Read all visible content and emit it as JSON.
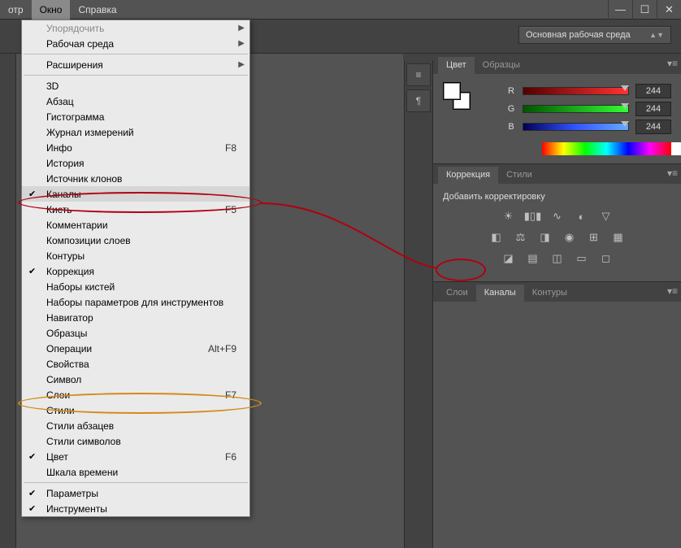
{
  "menubar": {
    "left_cut": "отр",
    "window": "Окно",
    "help": "Справка"
  },
  "win": {
    "min": "—",
    "max": "☐",
    "close": "✕"
  },
  "workspace": {
    "label": "Основная рабочая среда"
  },
  "dropdown": {
    "arrange": "Упорядочить",
    "workspace": "Рабочая среда",
    "extensions": "Расширения",
    "threeD": "3D",
    "paragraph": "Абзац",
    "histogram": "Гистограмма",
    "measurementLog": "Журнал измерений",
    "info": "Инфо",
    "info_sc": "F8",
    "history": "История",
    "cloneSrc": "Источник клонов",
    "channels": "Каналы",
    "brush": "Кисть",
    "brush_sc": "F5",
    "notes": "Комментарии",
    "layerComps": "Композиции слоев",
    "paths": "Контуры",
    "adjustments": "Коррекция",
    "brushPresets": "Наборы кистей",
    "toolPresets": "Наборы параметров для инструментов",
    "navigator": "Навигатор",
    "swatches": "Образцы",
    "actions": "Операции",
    "actions_sc": "Alt+F9",
    "properties": "Свойства",
    "character": "Символ",
    "layers": "Слои",
    "layers_sc": "F7",
    "styles": "Стили",
    "paraStyles": "Стили абзацев",
    "charStyles": "Стили символов",
    "color": "Цвет",
    "color_sc": "F6",
    "timeline": "Шкала времени",
    "options": "Параметры",
    "tools": "Инструменты"
  },
  "colorPanel": {
    "tab_color": "Цвет",
    "tab_swatches": "Образцы",
    "r_label": "R",
    "g_label": "G",
    "b_label": "B",
    "r_val": "244",
    "g_val": "244",
    "b_val": "244"
  },
  "adjPanel": {
    "tab_adjust": "Коррекция",
    "tab_styles": "Стили",
    "hint": "Добавить корректировку"
  },
  "layersPanel": {
    "tab_layers": "Слои",
    "tab_channels": "Каналы",
    "tab_paths": "Контуры"
  }
}
